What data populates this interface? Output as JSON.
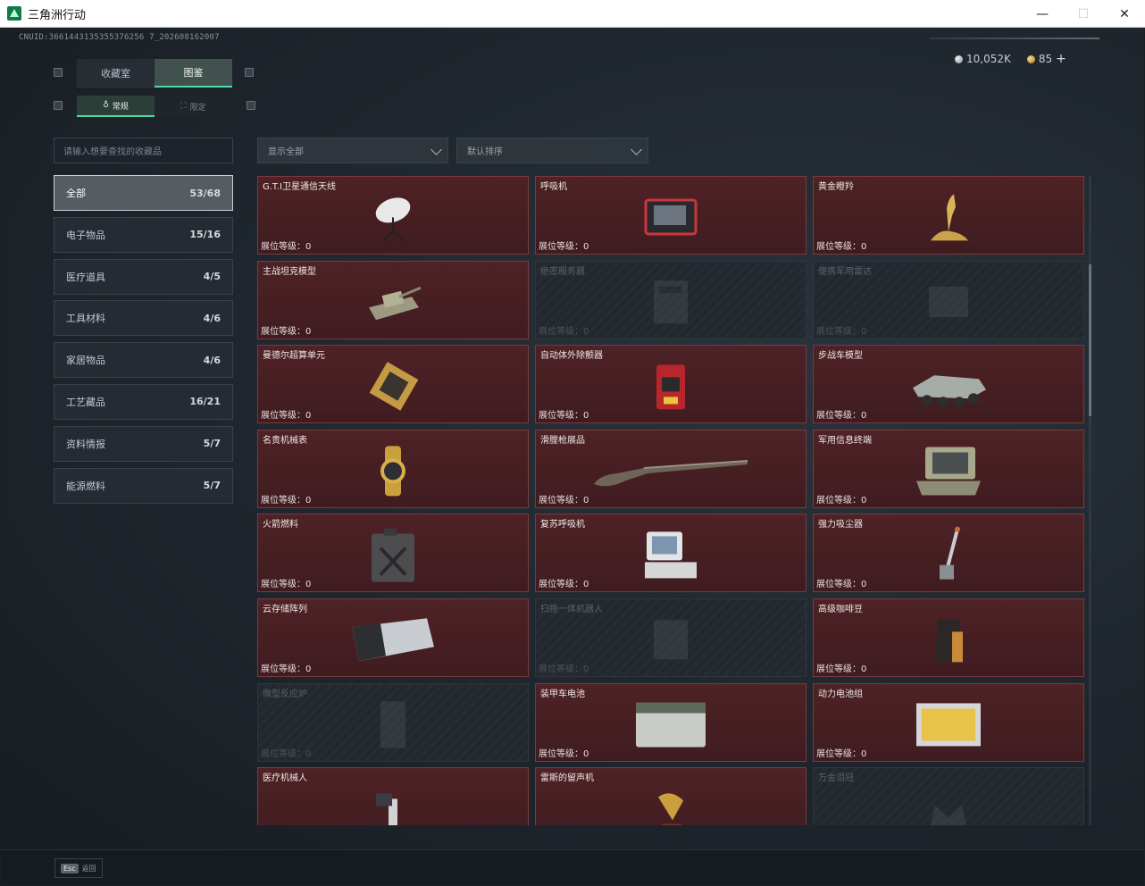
{
  "window": {
    "title": "三角洲行动",
    "minimize": "—",
    "maximize": "☐",
    "close": "✕"
  },
  "uid": "CNUID:3661443135355376256 7_202608162007",
  "currency": {
    "silver": "10,052K",
    "gold": "85",
    "plus": "+"
  },
  "main_tabs": [
    {
      "label": "收藏室"
    },
    {
      "label": "图鉴"
    }
  ],
  "sub_tabs": [
    {
      "label": "常规"
    },
    {
      "label": "限定"
    }
  ],
  "search": {
    "placeholder": "请输入想要查找的收藏品"
  },
  "filters": {
    "show": "显示全部",
    "sort": "默认排序"
  },
  "categories": [
    {
      "label": "全部",
      "count": "53/68"
    },
    {
      "label": "电子物品",
      "count": "15/16"
    },
    {
      "label": "医疗道具",
      "count": "4/5"
    },
    {
      "label": "工具材料",
      "count": "4/6"
    },
    {
      "label": "家居物品",
      "count": "4/6"
    },
    {
      "label": "工艺藏品",
      "count": "16/21"
    },
    {
      "label": "资料情报",
      "count": "5/7"
    },
    {
      "label": "能源燃料",
      "count": "5/7"
    }
  ],
  "level_label": "展位等级：",
  "items": [
    {
      "name": "G.T.I卫星通信天线",
      "level": "0",
      "icon": "satellite-dish-icon"
    },
    {
      "name": "呼吸机",
      "level": "0",
      "icon": "ventilator-icon"
    },
    {
      "name": "黄金瞪羚",
      "level": "0",
      "icon": "golden-gazelle-icon"
    },
    {
      "name": "主战坦克模型",
      "level": "0",
      "icon": "tank-model-icon"
    },
    {
      "name": "绝密服务器",
      "level": "0",
      "icon": "server-icon"
    },
    {
      "name": "便携军用雷达",
      "level": "0",
      "icon": "radar-icon"
    },
    {
      "name": "曼德尔超算单元",
      "level": "0",
      "icon": "cpu-unit-icon"
    },
    {
      "name": "自动体外除颤器",
      "level": "0",
      "icon": "defibrillator-icon"
    },
    {
      "name": "步战车模型",
      "level": "0",
      "icon": "ifv-model-icon"
    },
    {
      "name": "名贵机械表",
      "level": "0",
      "icon": "watch-icon"
    },
    {
      "name": "滑膛枪展品",
      "level": "0",
      "icon": "musket-icon"
    },
    {
      "name": "军用信息终端",
      "level": "0",
      "icon": "terminal-icon"
    },
    {
      "name": "火箭燃料",
      "level": "0",
      "icon": "fuel-can-icon"
    },
    {
      "name": "复苏呼吸机",
      "level": "0",
      "icon": "resuscitator-icon"
    },
    {
      "name": "强力吸尘器",
      "level": "0",
      "icon": "vacuum-icon"
    },
    {
      "name": "云存储阵列",
      "level": "0",
      "icon": "storage-array-icon"
    },
    {
      "name": "扫拖一体机器人",
      "level": "0",
      "icon": "robot-vacuum-icon"
    },
    {
      "name": "高级咖啡豆",
      "level": "0",
      "icon": "coffee-bag-icon"
    },
    {
      "name": "微型反应炉",
      "level": "0",
      "icon": "reactor-icon"
    },
    {
      "name": "装甲车电池",
      "level": "0",
      "icon": "battery-icon"
    },
    {
      "name": "动力电池组",
      "level": "0",
      "icon": "battery-pack-icon"
    },
    {
      "name": "医疗机械人",
      "level": "",
      "icon": "medical-robot-icon"
    },
    {
      "name": "雷斯的留声机",
      "level": "",
      "icon": "gramophone-icon"
    },
    {
      "name": "万金泪冠",
      "level": "",
      "icon": "crown-icon"
    }
  ],
  "esc": {
    "key": "Esc",
    "label": "返回"
  }
}
